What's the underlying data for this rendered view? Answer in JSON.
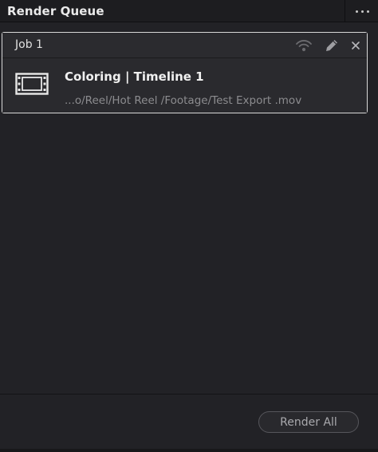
{
  "panel": {
    "title": "Render Queue",
    "more_icon": "more-horizontal-icon"
  },
  "jobs": [
    {
      "title": "Job 1",
      "icons": [
        "remote-render-icon",
        "edit-pencil-icon",
        "close-icon"
      ],
      "clip_title": "Coloring | Timeline 1",
      "clip_path": "...o/Reel/Hot Reel /Footage/Test Export .mov",
      "clip_icon": "film-strip-icon"
    }
  ],
  "footer": {
    "render_all_label": "Render All"
  },
  "colors": {
    "panel_bg": "#222226",
    "card_border": "#d8d8d8",
    "muted_text": "#8c8c8f"
  }
}
